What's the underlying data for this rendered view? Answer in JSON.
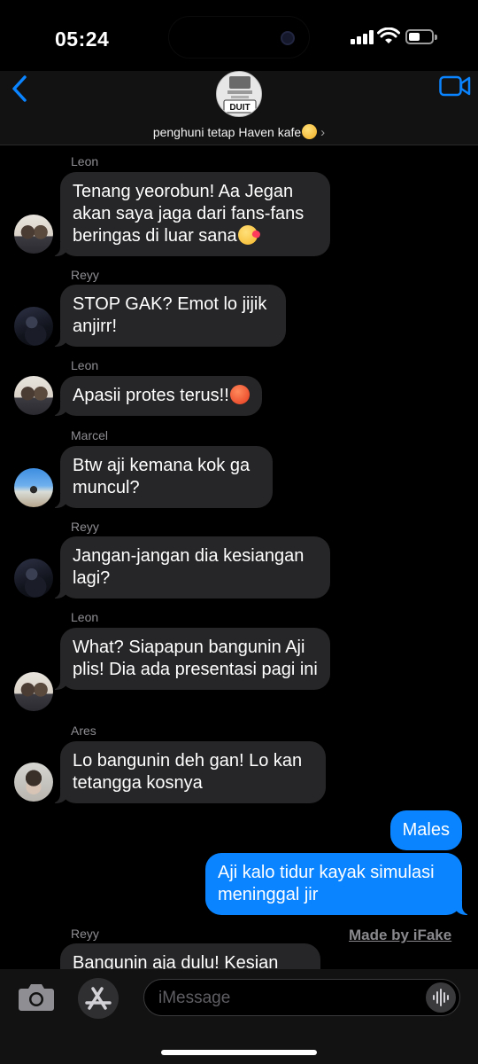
{
  "status_bar": {
    "time": "05:24",
    "battery_level": 0.5
  },
  "header": {
    "group_name": "penghuni tetap Haven kafe",
    "group_avatar_text": "DUIT",
    "back_icon": "chevron-left-icon",
    "video_icon": "video-camera-icon",
    "accent_color": "#0a84ff"
  },
  "messages": [
    {
      "sender": "Leon",
      "text": "Tenang yeorobun! Aa Jegan akan saya jaga dari fans-fans beringas di luar sana",
      "emoji": "face-blowing-kiss"
    },
    {
      "sender": "Reyy",
      "text": "STOP GAK? Emot lo jijik anjirr!"
    },
    {
      "sender": "Leon",
      "text": "Apasii protes terus!!",
      "emoji": "angry-face"
    },
    {
      "sender": "Marcel",
      "text": "Btw aji kemana kok ga muncul?"
    },
    {
      "sender": "Reyy",
      "text": "Jangan-jangan dia kesiangan lagi?"
    },
    {
      "sender": "Leon",
      "text": "What? Siapapun bangunin Aji plis! Dia ada presentasi pagi ini"
    },
    {
      "sender": "Ares",
      "text": "Lo bangunin deh gan! Lo kan tetangga kosnya"
    },
    {
      "sender": "me",
      "text": "Males"
    },
    {
      "sender": "me",
      "text": "Aji kalo tidur kayak simulasi meninggal jir"
    },
    {
      "sender": "Reyy",
      "text": "Bangunin aja dulu! Kesian"
    }
  ],
  "watermark": "Made by iFake",
  "input_bar": {
    "placeholder": "iMessage",
    "camera_icon": "camera-icon",
    "apps_icon": "app-store-icon",
    "voice_icon": "waveform-icon"
  }
}
